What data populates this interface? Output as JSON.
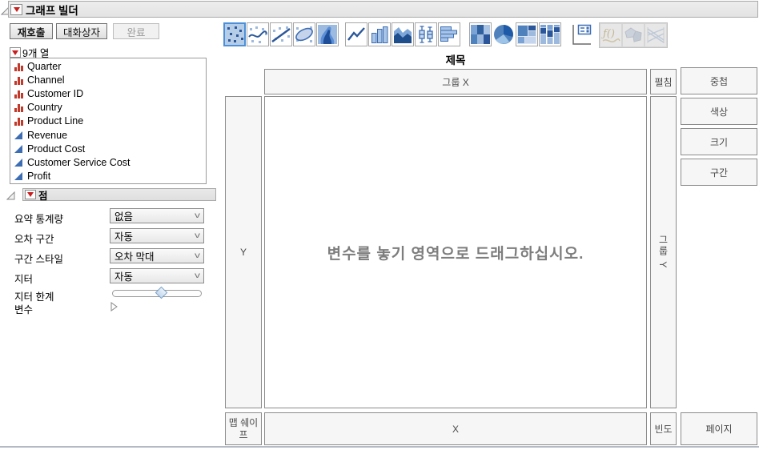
{
  "window": {
    "title": "그래프 빌더"
  },
  "action_buttons": {
    "recall": "재호출",
    "dialog": "대화상자",
    "done": "완료"
  },
  "columns_panel": {
    "header": "9개 열",
    "items": [
      {
        "label": "Quarter",
        "type": "nominal"
      },
      {
        "label": "Channel",
        "type": "nominal"
      },
      {
        "label": "Customer ID",
        "type": "nominal"
      },
      {
        "label": "Country",
        "type": "nominal"
      },
      {
        "label": "Product Line",
        "type": "nominal"
      },
      {
        "label": "Revenue",
        "type": "continuous"
      },
      {
        "label": "Product Cost",
        "type": "continuous"
      },
      {
        "label": "Customer Service Cost",
        "type": "continuous"
      },
      {
        "label": "Profit",
        "type": "continuous"
      }
    ]
  },
  "points_panel": {
    "header": "점",
    "rows": [
      {
        "label": "요약 통계량",
        "value": "없음"
      },
      {
        "label": "오차 구간",
        "value": "자동"
      },
      {
        "label": "구간 스타일",
        "value": "오차 막대"
      },
      {
        "label": "지터",
        "value": "자동"
      }
    ],
    "jitter_limit_label": "지터 한계",
    "jitter_limit_percent": 55,
    "variables_label": "변수"
  },
  "graph_toolbar": {
    "selected": "scatter-points",
    "disabled": [
      "formula",
      "map-shapes",
      "parallel-plot"
    ],
    "icons": [
      "scatter-points",
      "smoother",
      "line-of-fit",
      "ellipse",
      "contour-density",
      "line",
      "bar",
      "area",
      "box-plot",
      "histogram",
      "heatmap",
      "pie",
      "treemap",
      "mosaic",
      "caption-box",
      "formula",
      "map-shapes",
      "parallel-plot"
    ]
  },
  "canvas": {
    "title": "제목",
    "drop_hint": "변수를 놓기 영역으로 드래그하십시오.",
    "zones": {
      "group_x": "그룹 X",
      "wrap": "펼침",
      "overlay": "중첩",
      "color": "색상",
      "size": "크기",
      "interval": "구간",
      "y": "Y",
      "group_y": "그룹 Y",
      "map_shape": "맵 쉐이프",
      "x": "X",
      "frequency": "빈도",
      "page": "페이지"
    }
  },
  "colors": {
    "selection_accent": "#4d90d9",
    "selected_icon_bg": "#b6cde8",
    "red_marker": "#c81e1e",
    "nominal_icon_red": "#c0392b",
    "continuous_icon_blue": "#3d6eb4",
    "icon_blue_dark": "#2b579a",
    "icon_blue_mid": "#4f81bd",
    "icon_blue_light": "#9db9dd",
    "zone_bg": "#f6f6f6",
    "zone_border": "#8c8c8c",
    "hint_text": "#7d7d7d"
  }
}
